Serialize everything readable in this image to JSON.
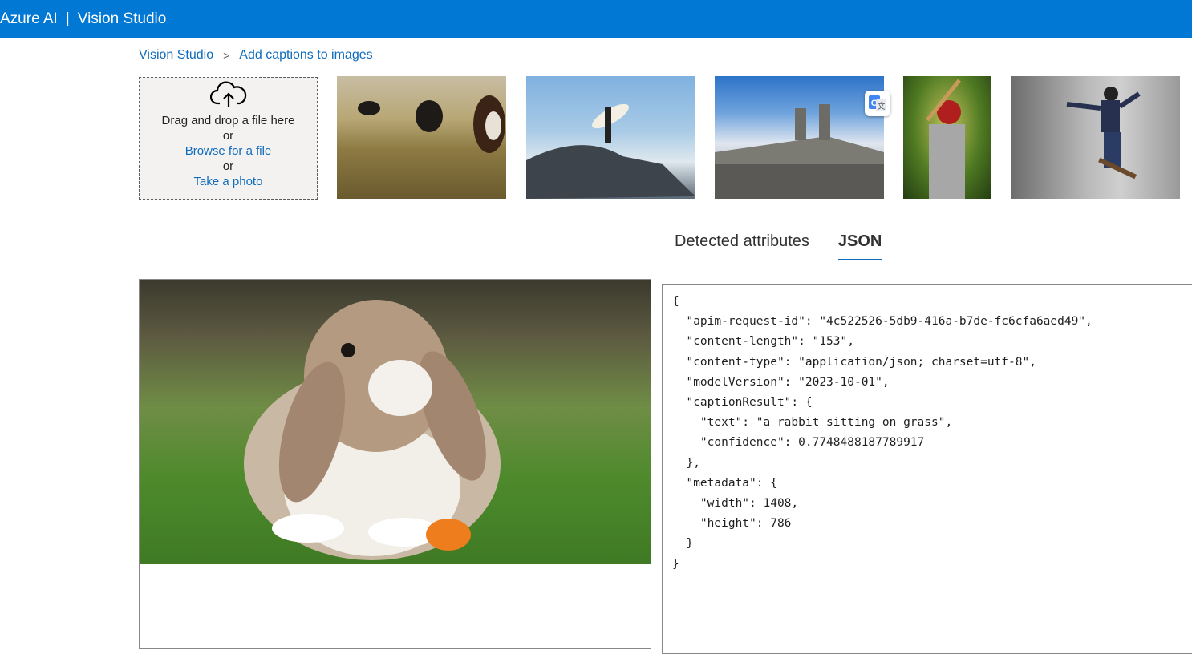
{
  "header": {
    "brand": "Azure AI",
    "separator": "|",
    "app": "Vision Studio"
  },
  "breadcrumb": {
    "root": "Vision Studio",
    "separator": ">",
    "current": "Add captions to images"
  },
  "upload": {
    "drag_text": "Drag and drop a file here",
    "or1": "or",
    "browse_label": "Browse for a file",
    "or2": "or",
    "photo_label": "Take a photo"
  },
  "tabs": [
    {
      "label": "Detected attributes",
      "active": false
    },
    {
      "label": "JSON",
      "active": true
    }
  ],
  "json_output": {
    "open": "{",
    "lines": [
      "  \"apim-request-id\": \"4c522526-5db9-416a-b7de-fc6cfa6aed49\",",
      "  \"content-length\": \"153\",",
      "  \"content-type\": \"application/json; charset=utf-8\",",
      "  \"modelVersion\": \"2023-10-01\",",
      "  \"captionResult\": {",
      "    \"text\": \"a rabbit sitting on grass\",",
      "    \"confidence\": 0.7748488187789917",
      "  },",
      "  \"metadata\": {",
      "    \"width\": 1408,",
      "    \"height\": 786",
      "  }"
    ],
    "close": "}"
  },
  "colors": {
    "header_bg": "#0078d4",
    "link": "#0f6cbd",
    "tab_underline": "#0f6cbd"
  },
  "icons": [
    "cloud-upload-icon",
    "translate-icon",
    "chevron-right-icon"
  ]
}
